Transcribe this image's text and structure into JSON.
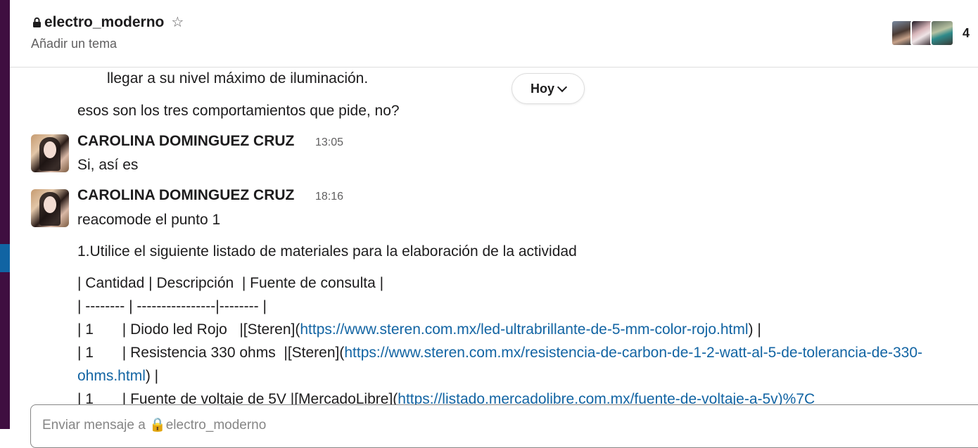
{
  "header": {
    "channel_name": "electro_moderno",
    "topic_placeholder": "Añadir un tema",
    "member_count": "4",
    "star_icon": "star-outline-icon",
    "lock_icon": "lock-icon"
  },
  "date_divider": {
    "label": "Hoy"
  },
  "messages": {
    "prev_line_1": "llegar a su nivel máximo de iluminación.",
    "prev_line_2": "esos son los tres comportamientos que pide, no?",
    "m1": {
      "author": "CAROLINA DOMINGUEZ CRUZ",
      "time": "13:05",
      "text": "Si, así es"
    },
    "m2": {
      "author": "CAROLINA DOMINGUEZ CRUZ",
      "time": "18:16",
      "lines": [
        "reacomode el punto 1",
        "1.Utilice el siguiente listado de materiales para la elaboración de la actividad",
        "| Cantidad | Descripción  | Fuente de consulta |",
        "| -------- | ----------------|-------- |"
      ],
      "row1": {
        "pre": "| 1       | Diodo led Rojo   |[Steren](",
        "link": "https://www.steren.com.mx/led-ultrabrillante-de-5-mm-color-rojo.html",
        "post": ") |"
      },
      "row2": {
        "pre": "| 1       | Resistencia 330 ohms  |[Steren](",
        "link": "https://www.steren.com.mx/resistencia-de-carbon-de-1-2-watt-al-5-de-tolerancia-de-330-",
        "link_cont": "ohms.html",
        "post": ") |"
      },
      "row3": {
        "pre": "| 1       | Fuente de voltaje de 5V |[MercadoLibre](",
        "link": "https://listado.mercadolibre.com.mx/fuente-de-voltaje-a-5v)%7C"
      }
    }
  },
  "composer": {
    "placeholder": "Enviar mensaje a 🔒electro_moderno"
  },
  "colors": {
    "sidebar": "#3f0e40",
    "active": "#1164a3",
    "link": "#1264a3"
  }
}
